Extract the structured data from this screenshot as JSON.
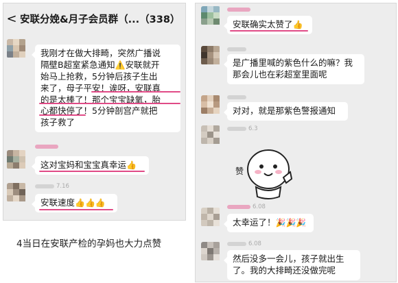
{
  "left": {
    "header": {
      "back_icon": "back-chevron-icon",
      "title": "安联分娩&月子会员群（...（338）"
    },
    "messages": [
      {
        "lines": [
          "我刚才在做大排畸，突然广播说",
          "隔壁B超室紧急通知",
          "始马上抢救，5分钟后孩子生出",
          "来了，母子平安！诶呀，安联真",
          "的是太棒了！那个宝宝缺氧，胎",
          "心都快停了！5分钟剖宫产就把",
          "孩子救了"
        ],
        "line2_suffix": "安联就开"
      },
      {
        "text": "这对宝妈和宝宝真幸运"
      },
      {
        "nick_suffix": "7.16",
        "text": "安联速度"
      }
    ]
  },
  "right": {
    "messages": [
      {
        "text": "安联确实太赞了"
      },
      {
        "lines": [
          "是广播里喊的紫色什么的嘛？我",
          "那会儿也在彩超室里面呢"
        ]
      },
      {
        "text": "对对，就是那紫色警报通知"
      },
      {
        "nick_suffix": "6.3"
      },
      {
        "nick_suffix": "6.08"
      },
      {
        "text": "太幸运了！"
      },
      {
        "nick_suffix": "6.08"
      },
      {
        "lines": [
          "然后没多一会儿，孩子就出生",
          "了。我的大排畸还没做完呢"
        ]
      }
    ],
    "sticker": {
      "label": "赞",
      "icon": "thumbs-up-sticker-icon"
    }
  },
  "caption": "4当日在安联产检的孕妈也大力点赞",
  "colors": {
    "underline": "#e04a86",
    "background": "#ededed",
    "bubble": "#ffffff"
  }
}
